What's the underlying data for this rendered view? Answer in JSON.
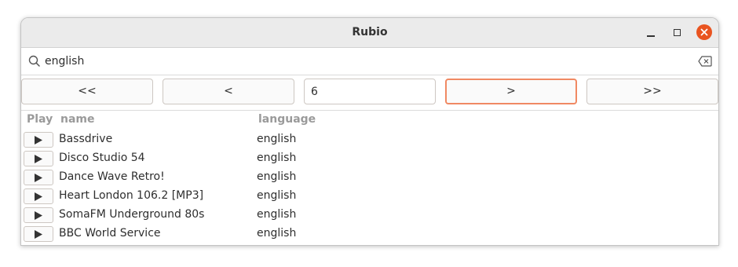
{
  "window": {
    "title": "Rubio"
  },
  "search": {
    "value": "english"
  },
  "pagination": {
    "first_label": "<<",
    "prev_label": "<",
    "page_value": "6",
    "next_label": ">",
    "last_label": ">>"
  },
  "table": {
    "headers": {
      "play": "Play",
      "name": "name",
      "language": "language"
    },
    "rows": [
      {
        "name": "Bassdrive",
        "language": "english"
      },
      {
        "name": "Disco Studio 54",
        "language": "english"
      },
      {
        "name": "Dance Wave Retro!",
        "language": "english"
      },
      {
        "name": "Heart London 106.2 [MP3]",
        "language": "english"
      },
      {
        "name": "SomaFM Underground 80s",
        "language": "english"
      },
      {
        "name": "BBC World Service",
        "language": "english"
      }
    ]
  },
  "icons": {
    "search": "search-icon",
    "clear": "backspace-clear-icon",
    "play": "play-icon",
    "close": "close-icon"
  },
  "colors": {
    "accent": "#e95420",
    "focus_border": "#f08963"
  }
}
